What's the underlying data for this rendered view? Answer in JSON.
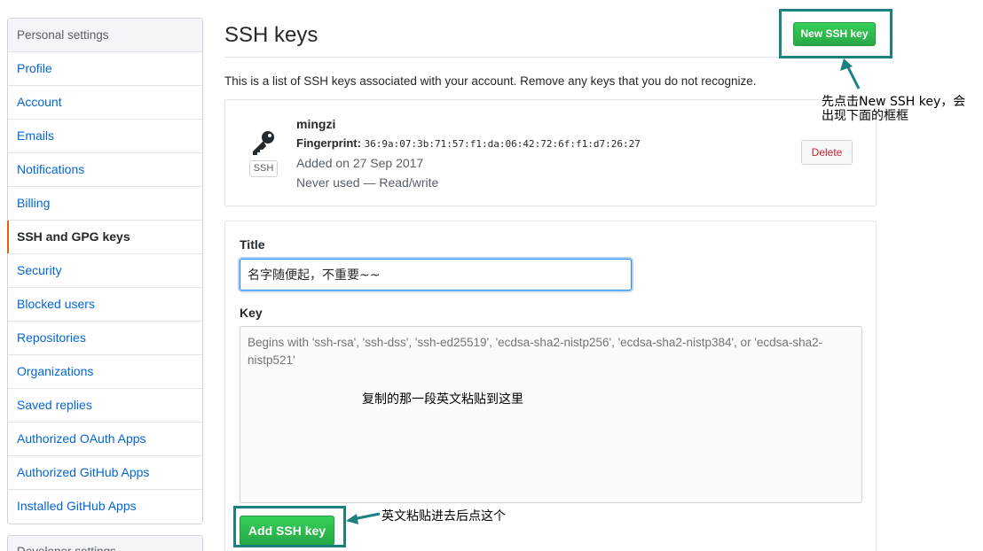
{
  "sidebar": {
    "header": "Personal settings",
    "items": [
      {
        "label": "Profile",
        "active": false
      },
      {
        "label": "Account",
        "active": false
      },
      {
        "label": "Emails",
        "active": false
      },
      {
        "label": "Notifications",
        "active": false
      },
      {
        "label": "Billing",
        "active": false
      },
      {
        "label": "SSH and GPG keys",
        "active": true
      },
      {
        "label": "Security",
        "active": false
      },
      {
        "label": "Blocked users",
        "active": false
      },
      {
        "label": "Repositories",
        "active": false
      },
      {
        "label": "Organizations",
        "active": false
      },
      {
        "label": "Saved replies",
        "active": false
      },
      {
        "label": "Authorized OAuth Apps",
        "active": false
      },
      {
        "label": "Authorized GitHub Apps",
        "active": false
      },
      {
        "label": "Installed GitHub Apps",
        "active": false
      }
    ],
    "second_header": "Developer settings"
  },
  "main": {
    "title": "SSH keys",
    "new_key_button": "New SSH key",
    "description": "This is a list of SSH keys associated with your account. Remove any keys that you do not recognize.",
    "key": {
      "icon": "key-icon",
      "badge": "SSH",
      "name": "mingzi",
      "fingerprint_label": "Fingerprint:",
      "fingerprint_value": "36:9a:07:3b:71:57:f1:da:06:42:72:6f:f1:d7:26:27",
      "added": "Added on 27 Sep 2017",
      "usage": "Never used — Read/write",
      "delete_button": "Delete"
    },
    "form": {
      "title_label": "Title",
      "title_value": "名字随便起，不重要~~",
      "key_label": "Key",
      "key_placeholder": "Begins with 'ssh-rsa', 'ssh-dss', 'ssh-ed25519', 'ecdsa-sha2-nistp256', 'ecdsa-sha2-nistp384', or 'ecdsa-sha2-nistp521'",
      "add_button": "Add SSH key"
    }
  },
  "annotations": {
    "new_key_line1": "先点击New SSH key，会",
    "new_key_line2": "出现下面的框框",
    "key_hint": "复制的那一段英文粘贴到这里",
    "add_hint": "英文粘贴进去后点这个"
  },
  "colors": {
    "accent_green": "#28a745",
    "link_blue": "#0366d6",
    "highlight_teal": "#1a8080",
    "active_marker": "#e36209",
    "danger_red": "#cb2431"
  }
}
